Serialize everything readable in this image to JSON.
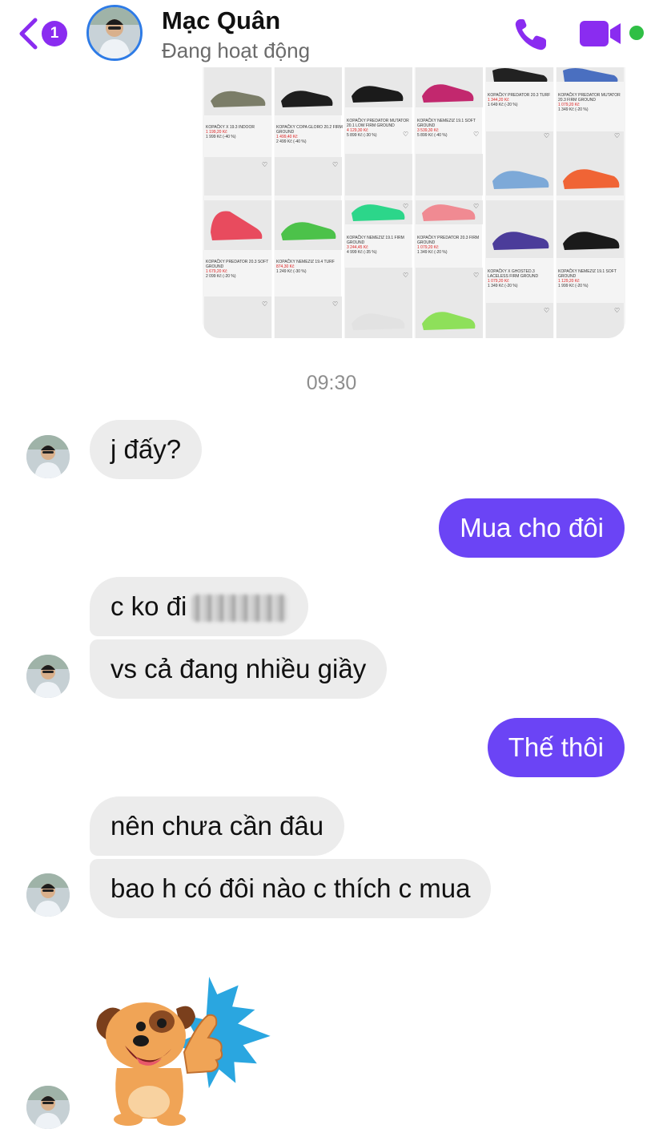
{
  "header": {
    "back_badge": "1",
    "contact_name": "Mạc Quân",
    "status": "Đang hoạt động"
  },
  "shop_preview": {
    "columns": [
      {
        "items": [
          {
            "title": "KOPAČKY X 19.3 INDOOR",
            "price": "1 199,20 Kč",
            "old": "1 999 Kč  (-40 %)"
          },
          {
            "title": "KOPAČKY PREDATOR 20.3 SOFT GROUND",
            "price": "1 679,20 Kč",
            "old": "2 099 Kč  (-20 %)"
          }
        ]
      },
      {
        "items": [
          {
            "title": "KOPAČKY COPA GLORO 20.2 FIRM GROUND",
            "price": "1 499,40 Kč",
            "old": "2 499 Kč  (-40 %)"
          },
          {
            "title": "KOPAČKY NEMEZIZ 19.4 TURF",
            "price": "874,30 Kč",
            "old": "1 249 Kč  (-30 %)"
          }
        ]
      },
      {
        "items": [
          {
            "title": "KOPAČKY PREDATOR MUTATOR 20.1 LOW FIRM GROUND",
            "price": "4 129,30 Kč",
            "old": "5 899 Kč  (-30 %)"
          },
          {
            "title": "KOPAČKY NEMEZIZ 19.1 FIRM GROUND",
            "price": "3 244,45 Kč",
            "old": "4 999 Kč  (-35 %)"
          }
        ]
      },
      {
        "items": [
          {
            "title": "KOPAČKY NEMEZIZ 19.1 SOFT GROUND",
            "price": "3 539,30 Kč",
            "old": "5 899 Kč  (-40 %)"
          },
          {
            "title": "KOPAČKY PREDATOR 20.3 FIRM GROUND",
            "price": "1 079,20 Kč",
            "old": "1 349 Kč  (-20 %)"
          }
        ]
      },
      {
        "items": [
          {
            "title": "KOPAČKY PREDATOR 20.3 TURF",
            "price": "1 344,20 Kč",
            "old": "1 649 Kč  (-20 %)"
          },
          {
            "title": "KOPAČKY X GHOSTED.3 LACELESS FIRM GROUND",
            "price": "1 079,20 Kč",
            "old": "1 349 Kč  (-20 %)"
          }
        ]
      },
      {
        "items": [
          {
            "title": "KOPAČKY PREDATOR MUTATOR 20.3 FIRM GROUND",
            "price": "1 079,20 Kč",
            "old": "1 349 Kč  (-20 %)"
          },
          {
            "title": "KOPAČKY NEMEZIZ 19.1 SOFT GROUND",
            "price": "1 129,20 Kč",
            "old": "1 999 Kč  (-20 %)"
          }
        ]
      }
    ]
  },
  "timestamp": "09:30",
  "messages": [
    {
      "side": "in",
      "text": "j đấy?"
    },
    {
      "side": "out",
      "text": "Mua cho đôi"
    },
    {
      "side": "in",
      "text": "c ko đi"
    },
    {
      "side": "in",
      "text": "vs cả đang nhiều giầy"
    },
    {
      "side": "out",
      "text": "Thế thôi"
    },
    {
      "side": "in",
      "text": "nên chưa cần đâu"
    },
    {
      "side": "in",
      "text": "bao h có đôi nào c thích c mua"
    }
  ],
  "colors": {
    "accent": "#8a2cf0",
    "outgoing_bubble": "#6b44f5",
    "incoming_bubble": "#ececec",
    "online_dot": "#2fbf45",
    "avatar_ring": "#2e7be6"
  },
  "icons": [
    "back-chevron-icon",
    "phone-icon",
    "video-camera-icon",
    "online-status-dot",
    "dog-thumbs-up-sticker"
  ]
}
